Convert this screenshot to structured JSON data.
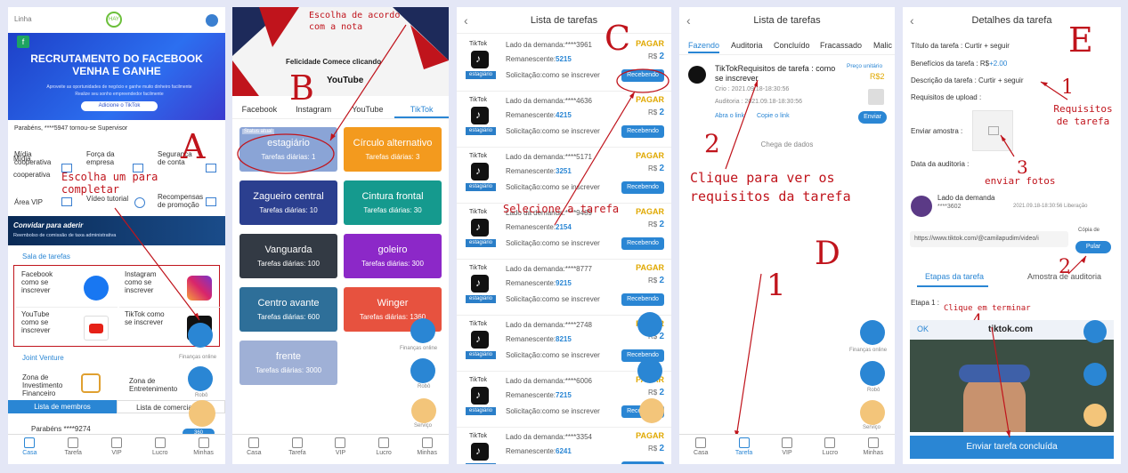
{
  "panelA": {
    "header_title": "Linha",
    "logo_text": "HAY",
    "banner_title": "RECRUTAMENTO DO FACEBOOK VENHA E GANHE",
    "banner_sub1": "Aproveite as oportunidades de negócio e ganhe muito dinheiro facilmente",
    "banner_sub2": "Realize seu sonho empreendedor facilmente",
    "banner_button": "Adicione o TikTok",
    "notice": "Parabéns, ****5947 tornou-se Supervisor",
    "menu": [
      "Mídia cooperativa",
      "Força da empresa",
      "Segurança de conta",
      "Área VIP",
      "Vídeo tutorial",
      "Recompensas de promoção"
    ],
    "invite_title": "Convidar para aderir",
    "invite_sub": "Reembolso de comissão de taxa administrativa",
    "hall_title": "Sala de tarefas",
    "services": [
      "Facebook como se inscrever",
      "Instagram como se inscrever",
      "YouTube como se inscrever",
      "TikTok como se inscrever"
    ],
    "jv_title": "Joint Venture",
    "jv_items": [
      "Zona de Investimento Financeiro",
      "Zona de Entretenimento"
    ],
    "finance_label": "Finanças online",
    "robot_label": "Robô",
    "tab_members": "Lista de membros",
    "tab_commerce": "Lista de comerciantes",
    "congrats2": "Parabéns ****9274",
    "congrats2_badge": "360",
    "annotation_A": "A",
    "annotation_text": "Escolha um para completar",
    "nav": [
      "Casa",
      "Tarefa",
      "VIP",
      "Lucro",
      "Minhas"
    ]
  },
  "panelB": {
    "banner_text": "Felicidade Comece clicando",
    "youtube": "YouTube",
    "annotation_text": "Escolha de acordo com a nota",
    "annotation_B": "B",
    "tabs": [
      "Facebook",
      "Instagram",
      "YouTube",
      "TikTok"
    ],
    "tiles": [
      {
        "badge": "Status atual",
        "title": "estagiário",
        "sub": "Tarefas diárias: 1",
        "color": "#8aa4d6"
      },
      {
        "title": "Círculo alternativo",
        "sub": "Tarefas diárias: 3",
        "color": "#f39a1e"
      },
      {
        "title": "Zagueiro central",
        "sub": "Tarefas diárias: 10",
        "color": "#2b3f8f"
      },
      {
        "title": "Cintura frontal",
        "sub": "Tarefas diárias: 30",
        "color": "#159a8e"
      },
      {
        "title": "Vanguarda",
        "sub": "Tarefas diárias: 100",
        "color": "#333a44"
      },
      {
        "title": "goleiro",
        "sub": "Tarefas diárias: 300",
        "color": "#8c28c8"
      },
      {
        "title": "Centro avante",
        "sub": "Tarefas diárias: 600",
        "color": "#2e6f99"
      },
      {
        "title": "Winger",
        "sub": "Tarefas diárias: 1360",
        "color": "#e7523f"
      },
      {
        "title": "frente",
        "sub": "Tarefas diárias: 3000",
        "color": "#9fb0d6"
      }
    ],
    "finance_label": "Finanças online",
    "robot_label": "Robô",
    "service_label": "Serviço",
    "nav": [
      "Casa",
      "Tarefa",
      "VIP",
      "Lucro",
      "Minhas"
    ]
  },
  "panelC": {
    "title": "Lista de tarefas",
    "annotation_C": "C",
    "annotation_text": "Selecione a tarefa",
    "rows": [
      {
        "demand": "Lado da demanda:****3961",
        "remain": "5215",
        "status": "PAGAR",
        "price": "2",
        "button": "Recebendo"
      },
      {
        "demand": "Lado da demanda:****4636",
        "remain": "4215",
        "status": "PAGAR",
        "price": "2",
        "button": "Recebendo"
      },
      {
        "demand": "Lado da demanda:****5171",
        "remain": "3251",
        "status": "PAGAR",
        "price": "2",
        "button": "Recebendo"
      },
      {
        "demand": "Lado da demanda:****9489",
        "remain": "2154",
        "status": "PAGAR",
        "price": "2",
        "button": "Recebendo"
      },
      {
        "demand": "Lado da demanda:****8777",
        "remain": "9215",
        "status": "PAGAR",
        "price": "2",
        "button": "Recebendo"
      },
      {
        "demand": "Lado da demanda:****2748",
        "remain": "8215",
        "status": "PAGAR",
        "price": "2",
        "button": "Recebendo"
      },
      {
        "demand": "Lado da demanda:****6006",
        "remain": "7215",
        "status": "PAGAR",
        "price": "2",
        "button": "Recebendo"
      },
      {
        "demand": "Lado da demanda:****3354",
        "remain": "6241",
        "status": "PAGAR",
        "price": "2",
        "button": "Recebendo"
      }
    ],
    "tiktok_label": "TikTok",
    "remain_label": "Remanescente:",
    "currency": "R$",
    "request_label": "Solicitação:como se inscrever",
    "badge": "estagiário",
    "finance_label": "Finanças online",
    "robot_label": "Robô",
    "service_label": "Serviço"
  },
  "panelD": {
    "title": "Lista de tarefas",
    "tabs": [
      "Fazendo",
      "Auditoria",
      "Concluído",
      "Fracassado",
      "Malic"
    ],
    "task_title": "TikTokRequisitos de tarefa : como se inscrever",
    "price_label": "Preço unitário",
    "price": "R$2",
    "created": "Crio : 2021.09.18-18:30:56",
    "audit": "Auditoria : 2021.09.18-18:30:56",
    "open_link": "Abra o link",
    "copy_link": "Copie o link",
    "send": "Enviar",
    "end_text": "Chega de dados",
    "annotation_2": "2",
    "annotation_text": "Clique para ver os requisitos da tarefa",
    "annotation_D": "D",
    "annotation_1": "1",
    "finance_label": "Finanças online",
    "robot_label": "Robô",
    "service_label": "Serviço",
    "nav": [
      "Casa",
      "Tarefa",
      "VIP",
      "Lucro",
      "Minhas"
    ]
  },
  "panelE": {
    "title": "Detalhes da tarefa",
    "annotation_E": "E",
    "task_title_label": "Título da tarefa : Curtir + seguir",
    "benefit_label": "Benefícios da tarefa : R$",
    "benefit_value": "+2.00",
    "desc_label": "Descrição da tarefa : Curtir + seguir",
    "upload_label": "Requisitos de upload :",
    "sample_label": "Enviar amostra :",
    "audit_date_label": "Data da auditoria :",
    "ann1": "1",
    "ann1_text": "Requisitos de tarefa",
    "ann3": "3",
    "ann3_text": "enviar fotos",
    "demand": "Lado da demanda",
    "demand_id": "****3602",
    "demand_time": "2021.09.18-18:30:56 Liberação",
    "link": "https://www.tiktok.com/@camilapudim/video/i",
    "copy": "Cópia de",
    "jump": "Pular",
    "ann2": "2",
    "tab_steps": "Etapas da tarefa",
    "tab_sample": "Amostra de auditoria",
    "step1": "Etapa 1 :",
    "ann4": "4",
    "ann4_text": "Clique em terminar",
    "ok": "OK",
    "tiktok_url": "tiktok.com",
    "submit": "Enviar tarefa concluída"
  }
}
